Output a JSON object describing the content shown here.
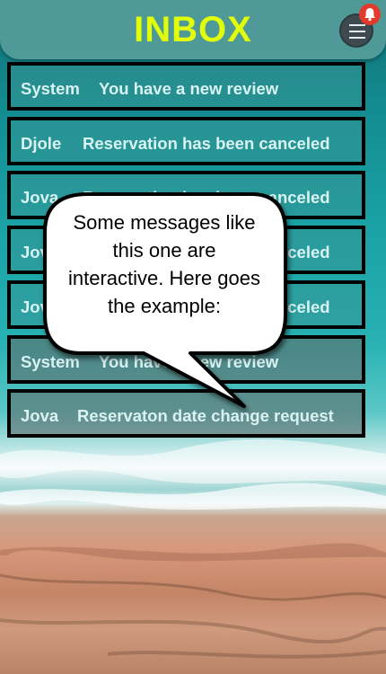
{
  "colors": {
    "title": "#e2ff0a",
    "badge": "#e23b2e",
    "message_text": "#d9f2f2"
  },
  "header": {
    "title": "INBOX",
    "menu_icon": "hamburger-menu-icon",
    "notification_icon": "bell-icon"
  },
  "messages": [
    {
      "sender": "System",
      "text": "You have a new review"
    },
    {
      "sender": "Djole",
      "text": "Reservation has been canceled"
    },
    {
      "sender": "Jova",
      "text": "Reservation has been canceled"
    },
    {
      "sender": "Jova",
      "text": "Reservation has been canceled"
    },
    {
      "sender": "Jova",
      "text": "Reservation has been canceled"
    },
    {
      "sender": "System",
      "text": "You have a new review"
    },
    {
      "sender": "Jova",
      "text": "Reservaton date change request"
    }
  ],
  "tooltip": {
    "line1": "Some messages like",
    "line2": "this one are",
    "line3": "interactive. Here goes",
    "line4": "the example:"
  }
}
